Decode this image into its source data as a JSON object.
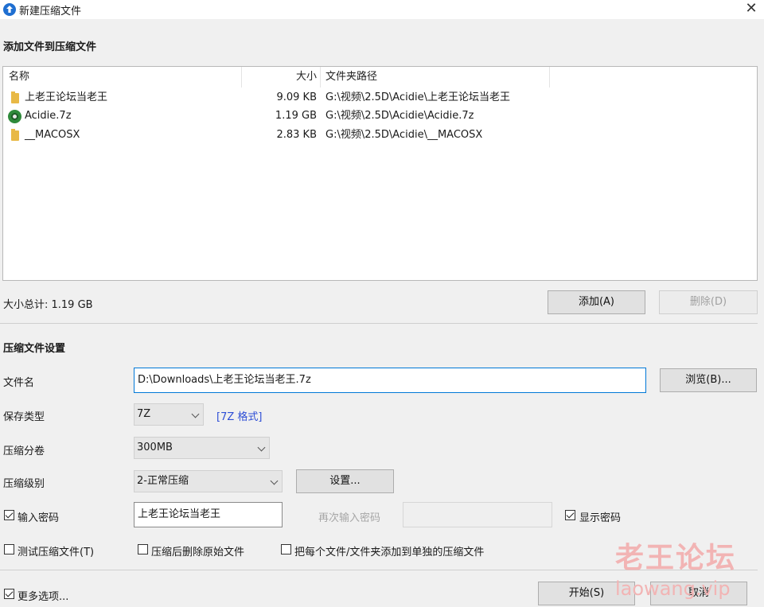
{
  "window": {
    "title": "新建压缩文件",
    "close_glyph": "✕"
  },
  "add_section": {
    "title": "添加文件到压缩文件"
  },
  "list": {
    "columns": {
      "name": "名称",
      "size": "大小",
      "path": "文件夹路径"
    },
    "rows": [
      {
        "icon": "folder-icon",
        "name": "上老王论坛当老王",
        "size": "9.09 KB",
        "path": "G:\\视频\\2.5D\\Acidie\\上老王论坛当老王"
      },
      {
        "icon": "7z-archive-icon",
        "name": "Acidie.7z",
        "size": "1.19 GB",
        "path": "G:\\视频\\2.5D\\Acidie\\Acidie.7z"
      },
      {
        "icon": "folder-icon",
        "name": "__MACOSX",
        "size": "2.83 KB",
        "path": "G:\\视频\\2.5D\\Acidie\\__MACOSX"
      }
    ]
  },
  "total": {
    "text": "大小总计: 1.19 GB"
  },
  "buttons": {
    "add": "添加(A)",
    "delete": "删除(D)",
    "browse": "浏览(B)...",
    "settings": "设置...",
    "start": "开始(S)",
    "cancel": "取消"
  },
  "settings_section": {
    "title": "压缩文件设置"
  },
  "fields": {
    "filename_label": "文件名",
    "filename_value": "D:\\Downloads\\上老王论坛当老王.7z",
    "save_type_label": "保存类型",
    "save_type_value": "7Z",
    "format_link": "[7Z 格式]",
    "split_label": "压缩分卷",
    "split_value": "300MB",
    "level_label": "压缩级别",
    "level_value": "2-正常压缩",
    "password_label": "输入密码",
    "password_value": "上老王论坛当老王",
    "password_confirm_label": "再次输入密码",
    "show_password_label": "显示密码"
  },
  "options": {
    "test_archive": "测试压缩文件(T)",
    "delete_after": "压缩后删除原始文件",
    "separate_archives": "把每个文件/文件夹添加到单独的压缩文件",
    "more_options": "更多选项..."
  },
  "watermark": {
    "cn": "老王论坛",
    "en": "laowang.vip"
  },
  "colors": {
    "accent": "#0078d7",
    "link": "#2f4fd6",
    "watermark": "#f2b4b4"
  }
}
